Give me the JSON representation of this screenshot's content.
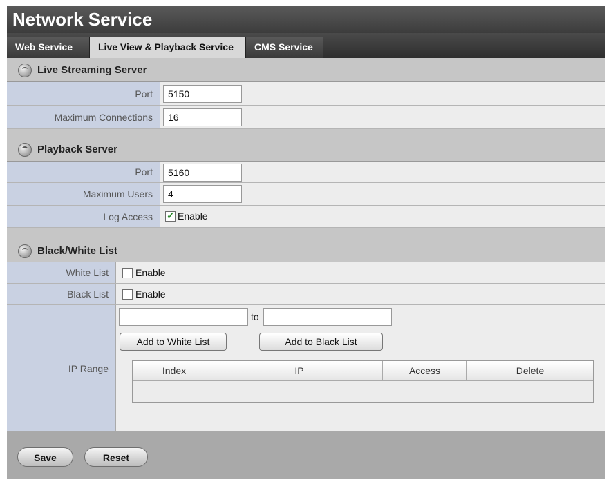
{
  "page": {
    "title": "Network Service"
  },
  "tabs": [
    {
      "label": "Web Service",
      "active": false
    },
    {
      "label": "Live View & Playback Service",
      "active": true
    },
    {
      "label": "CMS Service",
      "active": false
    }
  ],
  "live_streaming": {
    "header": "Live Streaming Server",
    "port_label": "Port",
    "port_value": "5150",
    "max_conn_label": "Maximum Connections",
    "max_conn_value": "16"
  },
  "playback": {
    "header": "Playback Server",
    "port_label": "Port",
    "port_value": "5160",
    "max_users_label": "Maximum Users",
    "max_users_value": "4",
    "log_access_label": "Log Access",
    "log_access_checked": true,
    "log_access_option": "Enable"
  },
  "bw_list": {
    "header": "Black/White List",
    "white_label": "White List",
    "white_checked": false,
    "white_option": "Enable",
    "black_label": "Black List",
    "black_checked": false,
    "black_option": "Enable",
    "ip_range_label": "IP Range",
    "from_value": "",
    "to_label": "to",
    "to_value": "",
    "add_white_button": "Add to White List",
    "add_black_button": "Add to Black List",
    "table_columns": [
      "Index",
      "IP",
      "Access",
      "Delete"
    ],
    "table_rows": []
  },
  "footer": {
    "save_label": "Save",
    "reset_label": "Reset"
  },
  "icons": {
    "section_icon": "globe-icon",
    "checkbox_checked": "check-icon"
  }
}
